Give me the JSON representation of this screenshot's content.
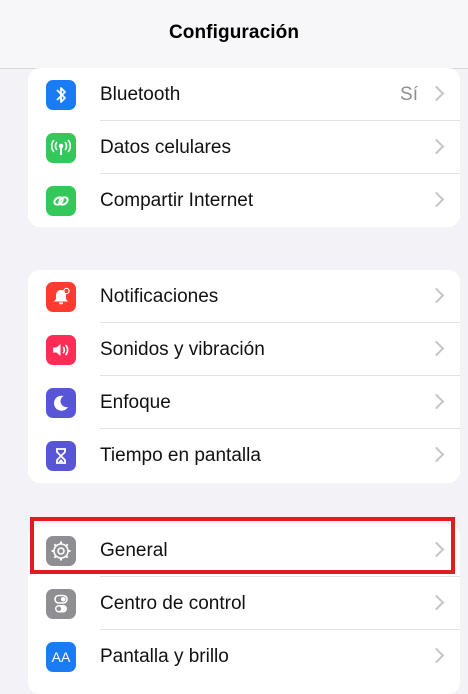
{
  "navbar": {
    "title": "Configuración"
  },
  "groups": [
    {
      "items": [
        {
          "label": "Bluetooth",
          "value": "Sí",
          "icon": "bluetooth-icon",
          "color": "#1a7cf5"
        },
        {
          "label": "Datos celulares",
          "icon": "antenna-icon",
          "color": "#34c759"
        },
        {
          "label": "Compartir Internet",
          "icon": "hotspot-link-icon",
          "color": "#34c759"
        }
      ]
    },
    {
      "items": [
        {
          "label": "Notificaciones",
          "icon": "bell-icon",
          "color": "#ff3b30"
        },
        {
          "label": "Sonidos y vibración",
          "icon": "speaker-icon",
          "color": "#ff2d55"
        },
        {
          "label": "Enfoque",
          "icon": "moon-icon",
          "color": "#5856d6"
        },
        {
          "label": "Tiempo en pantalla",
          "icon": "hourglass-icon",
          "color": "#5856d6"
        }
      ]
    },
    {
      "items": [
        {
          "label": "General",
          "icon": "gear-icon",
          "color": "#8e8e93"
        },
        {
          "label": "Centro de control",
          "icon": "toggles-icon",
          "color": "#8e8e93"
        },
        {
          "label": "Pantalla y brillo",
          "icon": "text-size-icon",
          "color": "#1a7cf5",
          "glyph": "AA"
        }
      ]
    }
  ],
  "highlight": {
    "target": "General",
    "color": "#e11b22"
  }
}
